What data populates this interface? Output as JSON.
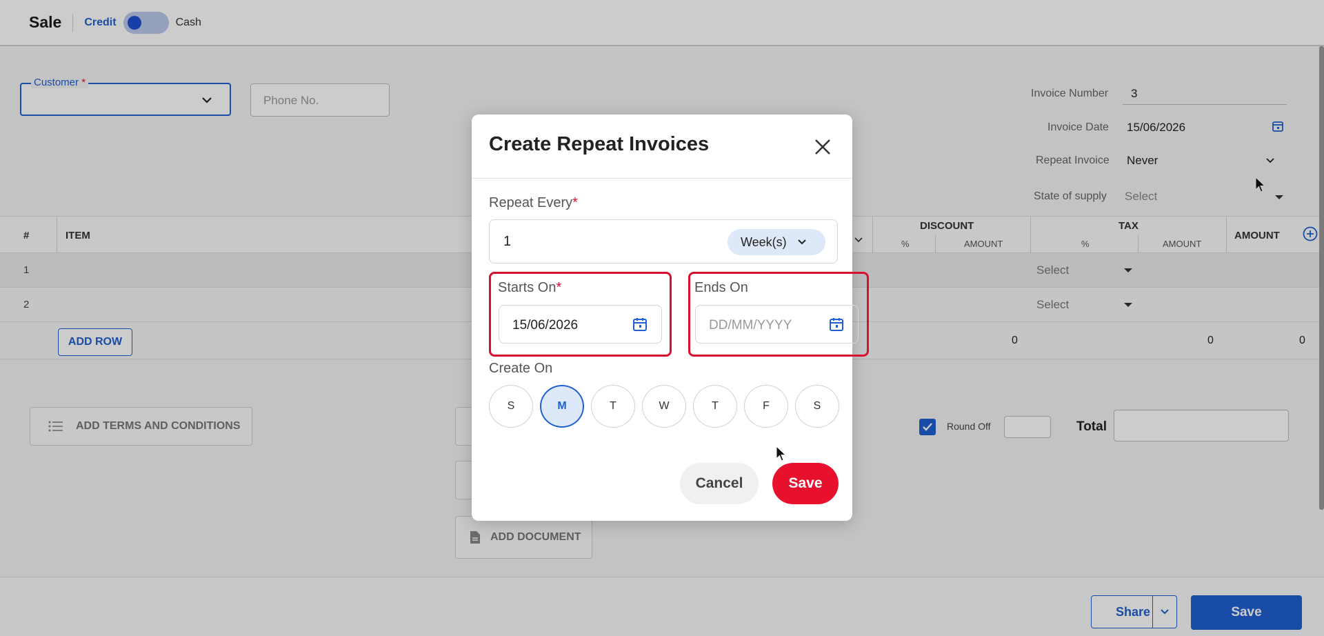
{
  "topbar": {
    "title": "Sale",
    "credit_label": "Credit",
    "cash_label": "Cash"
  },
  "form": {
    "customer_label": "Customer",
    "customer_required": "*",
    "phone_placeholder": "Phone No.",
    "invoice_number_label": "Invoice Number",
    "invoice_number_value": "3",
    "invoice_date_label": "Invoice Date",
    "invoice_date_value": "15/06/2026",
    "repeat_invoice_label": "Repeat Invoice",
    "repeat_invoice_value": "Never",
    "state_of_supply_label": "State of supply",
    "state_of_supply_value": "Select"
  },
  "table": {
    "col_hash": "#",
    "col_item": "ITEM",
    "col_discount": "DISCOUNT",
    "col_tax": "TAX",
    "col_amount": "AMOUNT",
    "sub_percent": "%",
    "sub_amount": "AMOUNT",
    "rows": [
      {
        "n": "1",
        "tax": "Select"
      },
      {
        "n": "2",
        "tax": "Select"
      }
    ],
    "add_row_label": "ADD ROW",
    "total_discount": "0",
    "total_tax": "0",
    "total_amount": "0"
  },
  "lower": {
    "terms_label": "ADD TERMS AND CONDITIONS",
    "document_label": "ADD DOCUMENT",
    "round_off_label": "Round Off",
    "total_label": "Total"
  },
  "footer": {
    "share_label": "Share",
    "save_label": "Save"
  },
  "modal": {
    "title": "Create Repeat Invoices",
    "repeat_every_label": "Repeat Every",
    "required_mark": "*",
    "repeat_every_value": "1",
    "repeat_unit": "Week(s)",
    "starts_on_label": "Starts On",
    "starts_on_value": "15/06/2026",
    "ends_on_label": "Ends On",
    "ends_on_placeholder": "DD/MM/YYYY",
    "create_on_label": "Create On",
    "days": [
      {
        "label": "S",
        "selected": false
      },
      {
        "label": "M",
        "selected": true
      },
      {
        "label": "T",
        "selected": false
      },
      {
        "label": "W",
        "selected": false
      },
      {
        "label": "T",
        "selected": false
      },
      {
        "label": "F",
        "selected": false
      },
      {
        "label": "S",
        "selected": false
      }
    ],
    "cancel_label": "Cancel",
    "save_label": "Save"
  },
  "colors": {
    "accent_blue": "#1f5fd1",
    "accent_red": "#e8112d",
    "highlight_red": "#d8102f",
    "pill_bg": "#dde9f8"
  }
}
